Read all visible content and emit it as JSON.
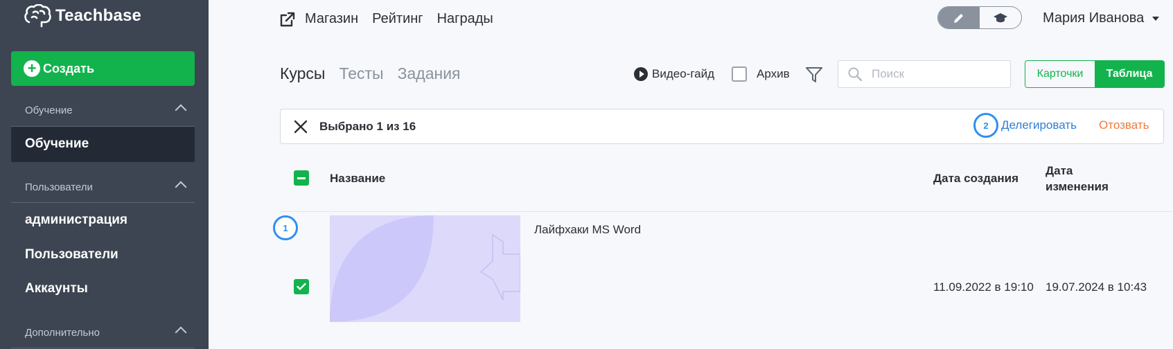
{
  "sidebar": {
    "logo_text": "Teachbase",
    "create_label": "Создать",
    "sections": [
      {
        "heading": "Обучение",
        "items": [
          "Обучение"
        ]
      },
      {
        "heading": "Пользователи",
        "items": [
          "администрация",
          "Пользователи",
          "Аккаунты"
        ]
      },
      {
        "heading": "Дополнительно",
        "items": []
      }
    ]
  },
  "topnav": {
    "links": [
      "Магазин",
      "Рейтинг",
      "Награды"
    ],
    "user_name": "Мария Иванова"
  },
  "tabs": [
    "Курсы",
    "Тесты",
    "Задания"
  ],
  "toolbar": {
    "video_guide": "Видео-гайд",
    "archive": "Архив",
    "search_placeholder": "Поиск",
    "view_cards": "Карточки",
    "view_table": "Таблица",
    "active_view": "Таблица"
  },
  "selection": {
    "count_text": "Выбрано 1 из 16",
    "delegate": "Делегировать",
    "revoke": "Отозвать",
    "badge_delegate": "2"
  },
  "table": {
    "headers": {
      "name": "Название",
      "created": "Дата создания",
      "modified_line1": "Дата",
      "modified_line2": "изменения"
    },
    "rows": [
      {
        "badge": "1",
        "checked": true,
        "name": "Лайфхаки MS Word",
        "created": "11.09.2022 в 19:10",
        "modified": "19.07.2024 в 10:43"
      }
    ]
  },
  "colors": {
    "accent_green": "#12b34d",
    "sidebar_bg": "#3d4552",
    "link_blue": "#2e7ed8",
    "revoke_orange": "#f07a3a",
    "badge_blue": "#2e8ff0"
  }
}
